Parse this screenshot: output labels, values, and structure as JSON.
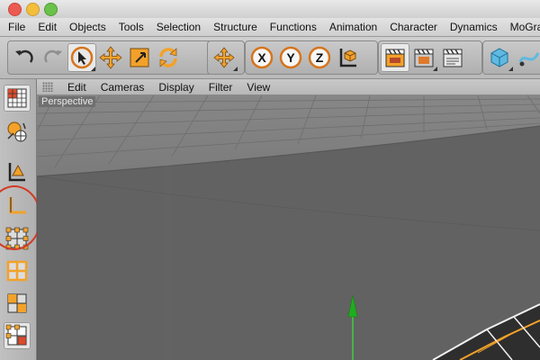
{
  "menus": [
    "File",
    "Edit",
    "Objects",
    "Tools",
    "Selection",
    "Structure",
    "Functions",
    "Animation",
    "Character",
    "Dynamics",
    "MoGra"
  ],
  "toolbar": {
    "undo_icon": "undo-arrow-icon",
    "redo_icon": "redo-arrow-icon",
    "axis_x_label": "X",
    "axis_y_label": "Y",
    "axis_z_label": "Z"
  },
  "view_menu": [
    "Edit",
    "Cameras",
    "Display",
    "Filter",
    "View"
  ],
  "viewport": {
    "label": "Perspective"
  },
  "colors": {
    "accent_orange": "#f2a22a",
    "highlight_red": "#d33a24",
    "grid_line": "#6a6a6a"
  }
}
